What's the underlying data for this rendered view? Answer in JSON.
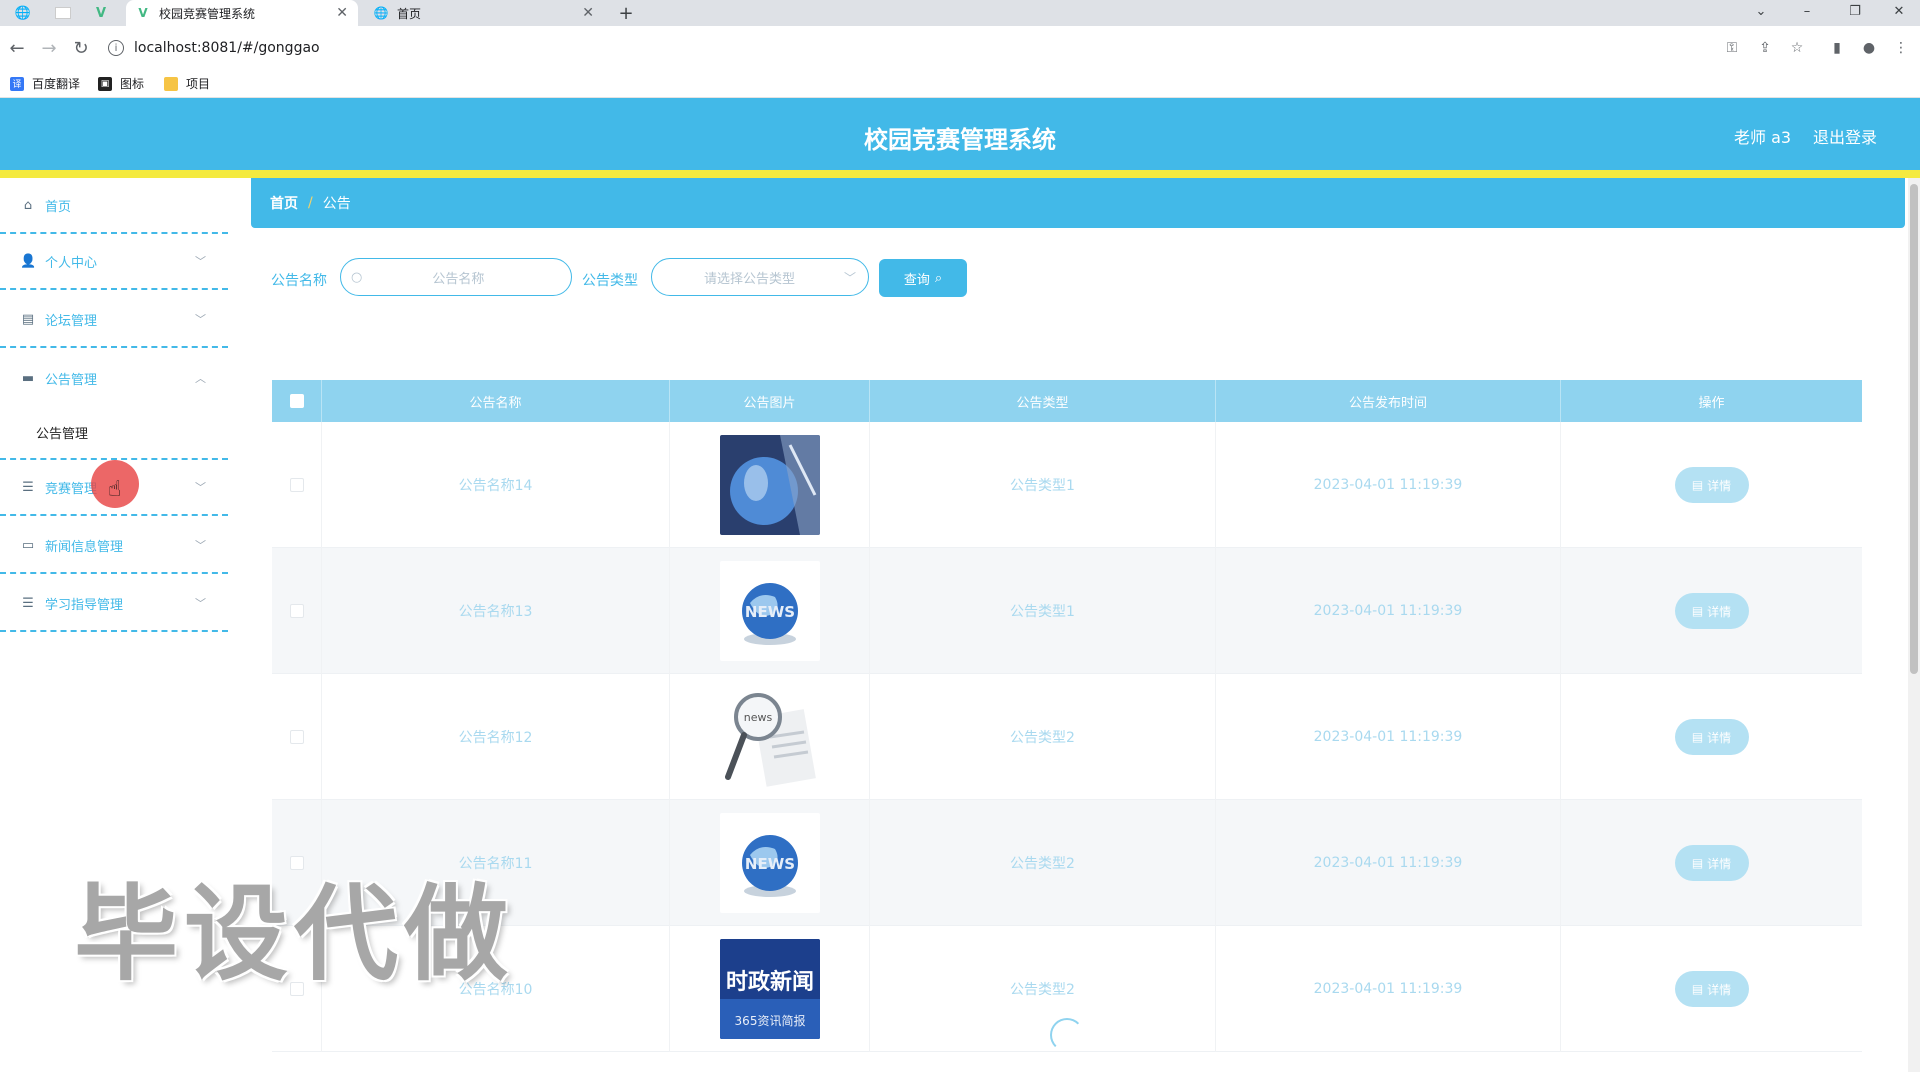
{
  "browser": {
    "tabs": [
      {
        "title": "校园竞赛管理系统",
        "active": true
      },
      {
        "title": "首页",
        "active": false
      }
    ],
    "url": "localhost:8081/#/gonggao",
    "bookmarks": [
      {
        "label": "百度翻译"
      },
      {
        "label": "图标"
      },
      {
        "label": "项目"
      }
    ]
  },
  "header": {
    "title": "校园竞赛管理系统",
    "user": "老师 a3",
    "logout": "退出登录"
  },
  "sidebar": {
    "items": [
      {
        "label": "首页",
        "icon": "home-icon"
      },
      {
        "label": "个人中心",
        "icon": "user-icon"
      },
      {
        "label": "论坛管理",
        "icon": "forum-icon"
      },
      {
        "label": "公告管理",
        "icon": "notice-icon",
        "expanded": true
      },
      {
        "label": "公告管理"
      },
      {
        "label": "竞赛管理",
        "icon": "list-icon"
      },
      {
        "label": "新闻信息管理",
        "icon": "news-icon"
      },
      {
        "label": "学习指导管理",
        "icon": "list-icon"
      }
    ]
  },
  "breadcrumb": {
    "home": "首页",
    "sep": "/",
    "current": "公告"
  },
  "search": {
    "name_label": "公告名称",
    "name_placeholder": "公告名称",
    "type_label": "公告类型",
    "type_placeholder": "请选择公告类型",
    "query_button": "查询"
  },
  "table": {
    "columns": [
      "公告名称",
      "公告图片",
      "公告类型",
      "公告发布时间",
      "操作"
    ],
    "detail_label": "详情",
    "rows": [
      {
        "name": "公告名称14",
        "image": "globe-photo",
        "type": "公告类型1",
        "time": "2023-04-01 11:19:39"
      },
      {
        "name": "公告名称13",
        "image": "news-globe",
        "type": "公告类型1",
        "time": "2023-04-01 11:19:39"
      },
      {
        "name": "公告名称12",
        "image": "news-magnifier",
        "type": "公告类型2",
        "time": "2023-04-01 11:19:39"
      },
      {
        "name": "公告名称11",
        "image": "news-globe",
        "type": "公告类型2",
        "time": "2023-04-01 11:19:39"
      },
      {
        "name": "公告名称10",
        "image": "politics-news-banner",
        "type": "公告类型2",
        "time": "2023-04-01 11:19:39"
      }
    ]
  },
  "image_texts": {
    "news": "NEWS",
    "news_small": "news",
    "politics_title": "时政新闻",
    "politics_sub": "365资讯简报"
  },
  "watermark": "毕设代做",
  "colors": {
    "primary": "#42b9e8",
    "accent": "#f4ea3f",
    "header_bg": "#8fd3ef"
  }
}
